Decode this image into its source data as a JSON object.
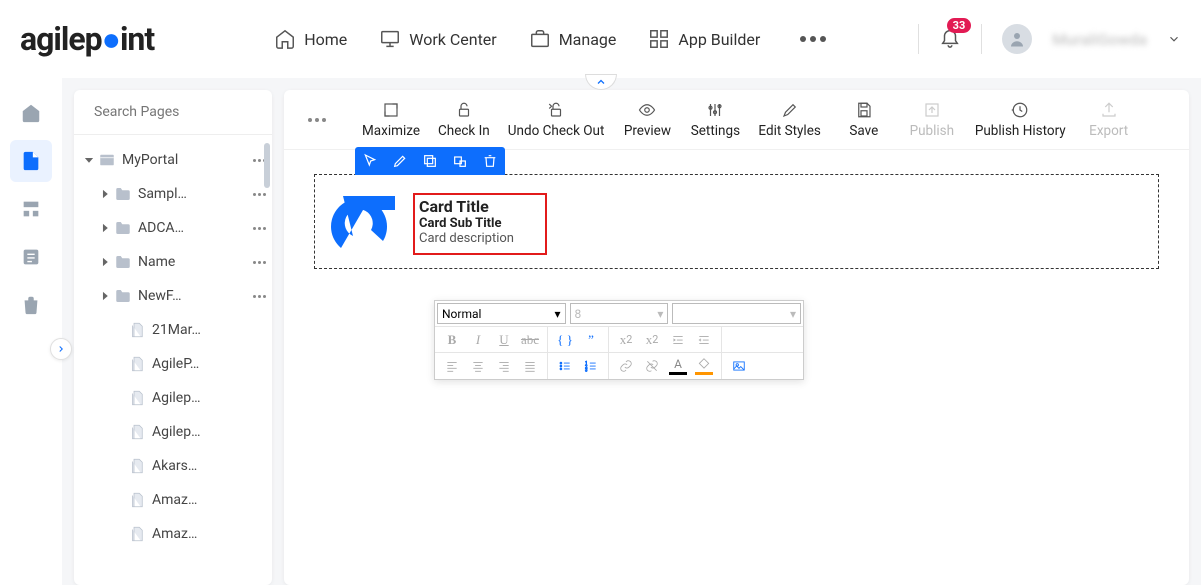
{
  "logo": {
    "text_pre": "agilep",
    "text_post": "int"
  },
  "nav": {
    "home": "Home",
    "workcenter": "Work Center",
    "manage": "Manage",
    "appbuilder": "App Builder"
  },
  "notifications": {
    "count": "33"
  },
  "user": {
    "name": "MuraliGowda"
  },
  "search": {
    "placeholder": "Search Pages"
  },
  "tree": {
    "root": "MyPortal",
    "folders": [
      "Sampl…",
      "ADCA…",
      "Name",
      "NewF…"
    ],
    "pages": [
      "21Mar…",
      "AgileP…",
      "Agilep…",
      "Agilep…",
      "Akars…",
      "Amaz…",
      "Amaz…"
    ]
  },
  "toolbar": {
    "maximize": "Maximize",
    "checkin": "Check In",
    "undocheckout": "Undo Check Out",
    "preview": "Preview",
    "settings": "Settings",
    "editstyles": "Edit Styles",
    "save": "Save",
    "publish": "Publish",
    "publishhistory": "Publish History",
    "export": "Export"
  },
  "card": {
    "title": "Card Title",
    "subtitle": "Card Sub Title",
    "description": "Card description"
  },
  "rte": {
    "format": "Normal",
    "fontsize": "8"
  }
}
